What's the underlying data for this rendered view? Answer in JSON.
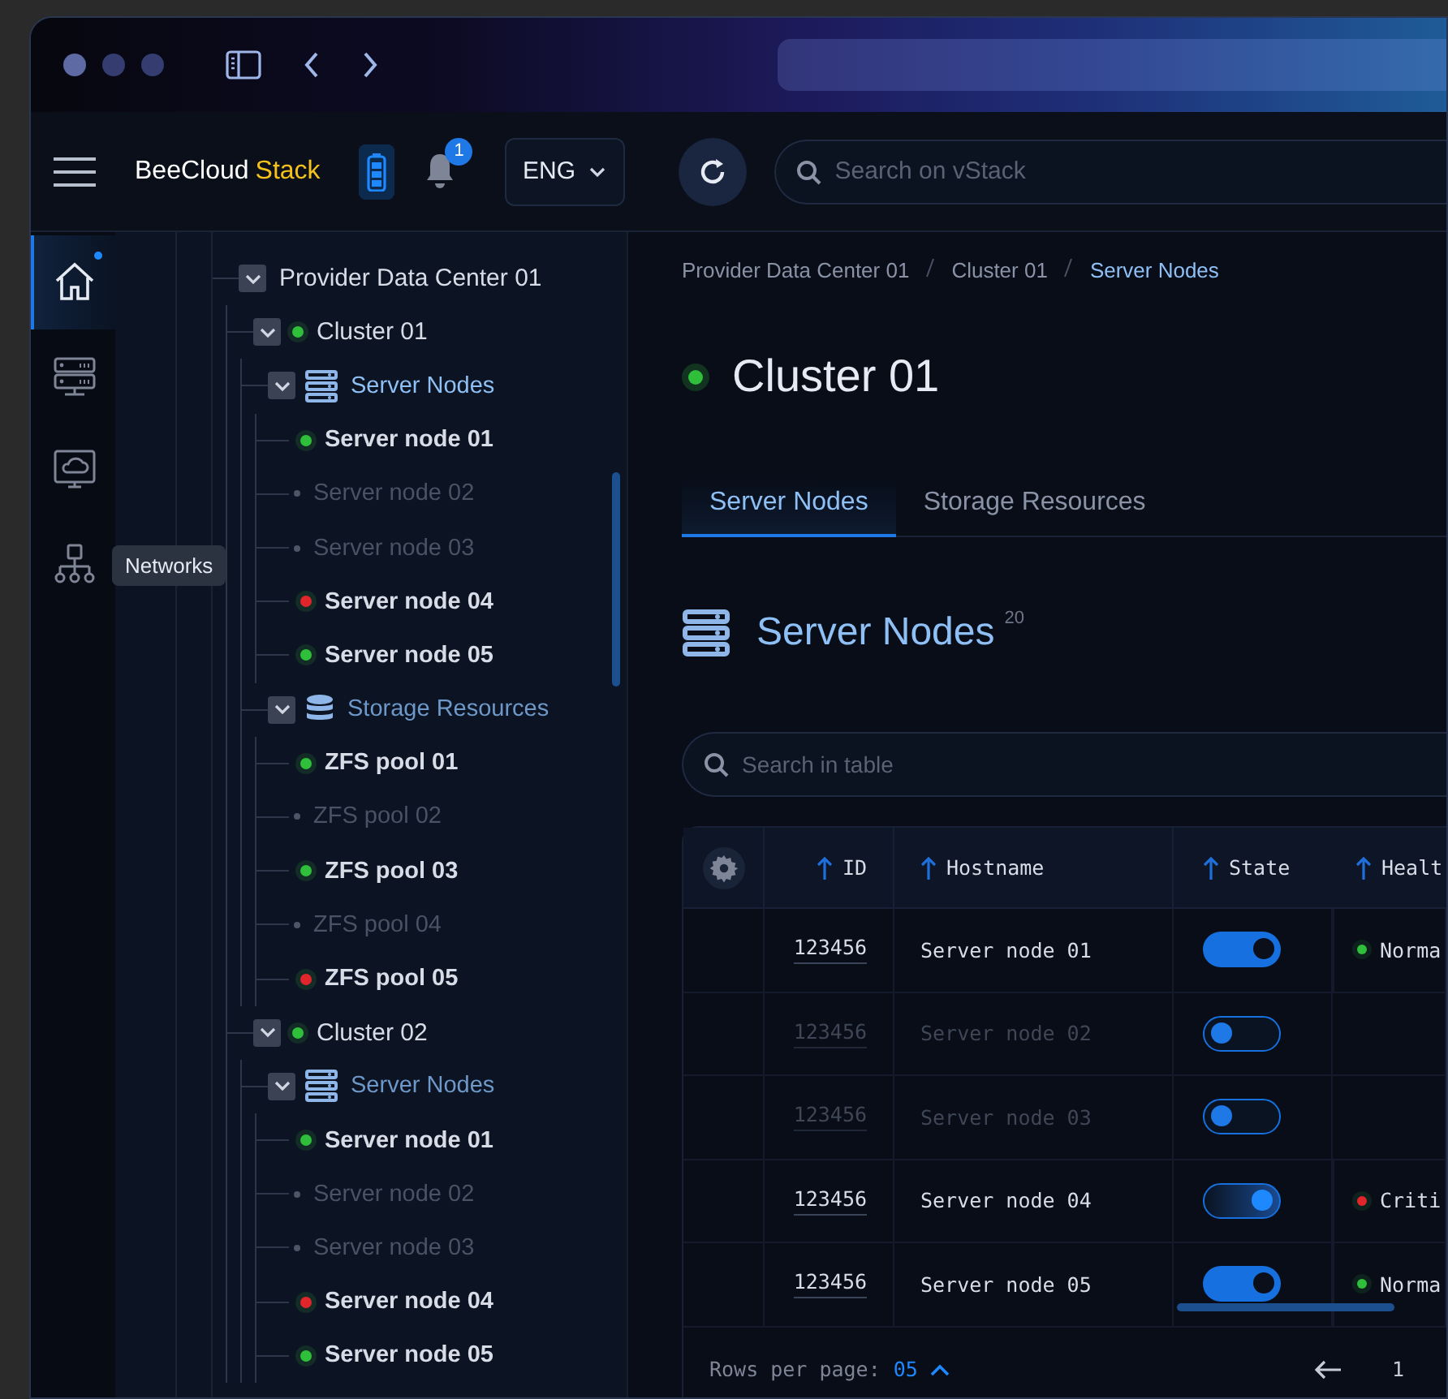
{
  "header": {
    "brand": "BeeCloud",
    "product": "Stack",
    "notifications": {
      "count": "1"
    },
    "language": "ENG",
    "search": {
      "placeholder": "Search on vStack"
    }
  },
  "nav_rail": {
    "items": [
      {
        "kind": "home",
        "selected": true,
        "alert": true
      },
      {
        "kind": "servers",
        "selected": false
      },
      {
        "kind": "cloud",
        "selected": false
      },
      {
        "kind": "network",
        "selected": false,
        "tooltip": "Networks"
      }
    ]
  },
  "tree": [
    {
      "label": "Provider Data Center 01",
      "kind": "group",
      "expanded": true,
      "selected": false,
      "children": [
        {
          "label": "Cluster 01",
          "kind": "group",
          "color": "#2fbf3a",
          "expanded": true,
          "selected": false,
          "children": [
            {
              "label": "Server Nodes",
              "kind": "servers",
              "expanded": true,
              "selected": true,
              "children": [
                {
                  "label": "Server node 01",
                  "kind": "leaf",
                  "color": "#2fbf3a",
                  "disabled": false,
                  "selected": false
                },
                {
                  "label": "Server node 02",
                  "kind": "leaf",
                  "color": "#4d5566",
                  "disabled": true,
                  "selected": false
                },
                {
                  "label": "Server node 03",
                  "kind": "leaf",
                  "color": "#4d5566",
                  "disabled": true,
                  "selected": false
                },
                {
                  "label": "Server node 04",
                  "kind": "leaf",
                  "color": "#e0262b",
                  "disabled": false,
                  "selected": false
                },
                {
                  "label": "Server node 05",
                  "kind": "leaf",
                  "color": "#2fbf3a",
                  "disabled": false,
                  "selected": false
                }
              ]
            },
            {
              "label": "Storage Resources",
              "kind": "storage",
              "expanded": true,
              "selected": false,
              "children": [
                {
                  "label": "ZFS pool 01",
                  "kind": "leaf",
                  "color": "#2fbf3a",
                  "disabled": false,
                  "selected": false
                },
                {
                  "label": "ZFS pool 02",
                  "kind": "leaf",
                  "color": "#4d5566",
                  "disabled": true,
                  "selected": false
                },
                {
                  "label": "ZFS pool 03",
                  "kind": "leaf",
                  "color": "#2fbf3a",
                  "disabled": false,
                  "selected": false
                },
                {
                  "label": "ZFS pool 04",
                  "kind": "leaf",
                  "color": "#4d5566",
                  "disabled": true,
                  "selected": false
                },
                {
                  "label": "ZFS pool 05",
                  "kind": "leaf",
                  "color": "#e0262b",
                  "disabled": false,
                  "selected": false
                }
              ]
            }
          ]
        },
        {
          "label": "Cluster 02",
          "kind": "group",
          "color": "#2fbf3a",
          "expanded": true,
          "selected": false,
          "children": [
            {
              "label": "Server Nodes",
              "kind": "servers",
              "expanded": true,
              "selected": false,
              "children": [
                {
                  "label": "Server node 01",
                  "kind": "leaf",
                  "color": "#2fbf3a",
                  "disabled": false,
                  "selected": false
                },
                {
                  "label": "Server node 02",
                  "kind": "leaf",
                  "color": "#4d5566",
                  "disabled": true,
                  "selected": false
                },
                {
                  "label": "Server node 03",
                  "kind": "leaf",
                  "color": "#4d5566",
                  "disabled": true,
                  "selected": false
                },
                {
                  "label": "Server node 04",
                  "kind": "leaf",
                  "color": "#e0262b",
                  "disabled": false,
                  "selected": false
                },
                {
                  "label": "Server node 05",
                  "kind": "leaf",
                  "color": "#2fbf3a",
                  "disabled": false,
                  "selected": false
                }
              ]
            }
          ]
        }
      ]
    }
  ],
  "breadcrumb": [
    {
      "label": "Provider Data Center 01",
      "selected": false
    },
    {
      "label": "Cluster 01",
      "selected": false
    },
    {
      "label": "Server Nodes",
      "selected": true
    }
  ],
  "page_title": {
    "text": "Cluster 01",
    "color": "#2fbf3a"
  },
  "tabs": [
    {
      "label": "Server Nodes",
      "selected": true
    },
    {
      "label": "Storage Resources",
      "selected": false
    }
  ],
  "section": {
    "title": "Server Nodes",
    "count": "20"
  },
  "table": {
    "search": {
      "placeholder": "Search in table"
    },
    "columns": [
      {
        "kind": "settings"
      },
      {
        "kind": "sort",
        "label": "ID"
      },
      {
        "kind": "sort",
        "label": "Hostname"
      },
      {
        "kind": "sort",
        "label": "State"
      },
      {
        "kind": "sort",
        "label": "Healt"
      }
    ],
    "rows": [
      {
        "id": "123456",
        "hostname": "Server node 01",
        "disabled": false,
        "on": true,
        "pending": false,
        "health": {
          "text": "Norma",
          "color": "#2fbf3a"
        }
      },
      {
        "id": "123456",
        "hostname": "Server node 02",
        "disabled": true,
        "on": false,
        "pending": false
      },
      {
        "id": "123456",
        "hostname": "Server node 03",
        "disabled": true,
        "on": false,
        "pending": false
      },
      {
        "id": "123456",
        "hostname": "Server node 04",
        "disabled": false,
        "on": true,
        "pending": true,
        "health": {
          "text": "Criti",
          "color": "#e0262b"
        }
      },
      {
        "id": "123456",
        "hostname": "Server node 05",
        "disabled": false,
        "on": true,
        "pending": false,
        "health": {
          "text": "Norma",
          "color": "#2fbf3a"
        }
      }
    ],
    "pagination": {
      "label": "Rows per page:",
      "value": "05",
      "page": "1"
    }
  }
}
